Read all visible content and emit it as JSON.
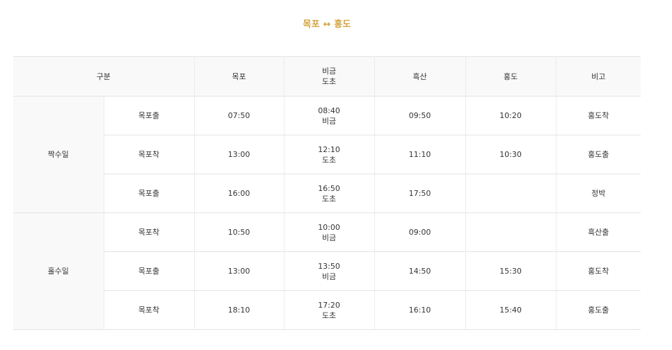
{
  "title": "목포 ↔ 홍도",
  "header": {
    "category": "구분",
    "mokpo": "목포",
    "bigeum_line1": "비금",
    "bigeum_line2": "도초",
    "heuksan": "흑산",
    "hongdo": "홍도",
    "note": "비고"
  },
  "groups": [
    {
      "day": "짝수일",
      "rows": [
        {
          "direction": "목포출",
          "mokpo": "07:50",
          "bigeum_time": "08:40",
          "bigeum_port": "비금",
          "heuksan": "09:50",
          "hongdo": "10:20",
          "note": "홍도착"
        },
        {
          "direction": "목포착",
          "mokpo": "13:00",
          "bigeum_time": "12:10",
          "bigeum_port": "도초",
          "heuksan": "11:10",
          "hongdo": "10:30",
          "note": "홍도출"
        },
        {
          "direction": "목포출",
          "mokpo": "16:00",
          "bigeum_time": "16:50",
          "bigeum_port": "도초",
          "heuksan": "17:50",
          "hongdo": "",
          "note": "정박"
        }
      ]
    },
    {
      "day": "홀수일",
      "rows": [
        {
          "direction": "목포착",
          "mokpo": "10:50",
          "bigeum_time": "10:00",
          "bigeum_port": "비금",
          "heuksan": "09:00",
          "hongdo": "",
          "note": "흑산출"
        },
        {
          "direction": "목포출",
          "mokpo": "13:00",
          "bigeum_time": "13:50",
          "bigeum_port": "비금",
          "heuksan": "14:50",
          "hongdo": "15:30",
          "note": "홍도착"
        },
        {
          "direction": "목포착",
          "mokpo": "18:10",
          "bigeum_time": "17:20",
          "bigeum_port": "도초",
          "heuksan": "16:10",
          "hongdo": "15:40",
          "note": "홍도출"
        }
      ]
    }
  ]
}
